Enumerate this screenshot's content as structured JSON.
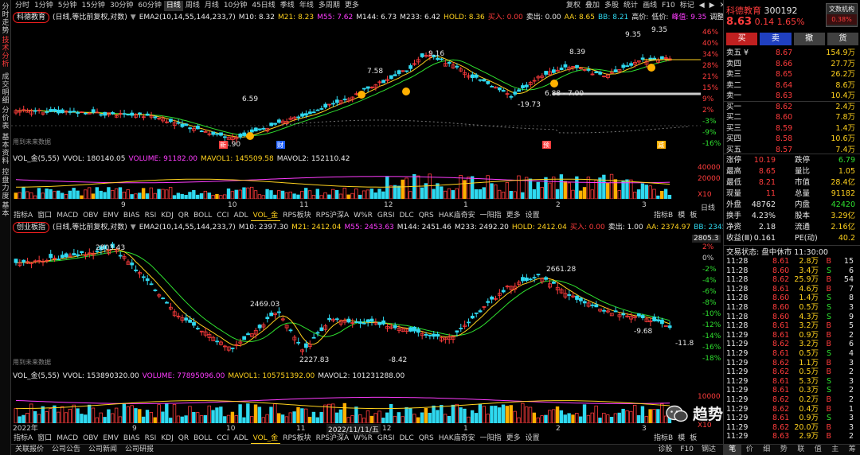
{
  "left_tabs": [
    "分时走势",
    "技术分析",
    "成交明细",
    "分价表",
    "基本资料",
    "控盘力度",
    "基本"
  ],
  "periods": [
    "分时",
    "1分钟",
    "5分钟",
    "15分钟",
    "30分钟",
    "60分钟",
    "日线",
    "周线",
    "月线",
    "10分钟",
    "45日线",
    "季线",
    "年线",
    "多周期",
    "更多"
  ],
  "periods_selected": "日线",
  "toolbar": [
    "复权",
    "叠加",
    "多股",
    "统计",
    "画线",
    "F10",
    "标记",
    "◀",
    "▶",
    "✕"
  ],
  "upper": {
    "stock_label": "科德教育",
    "mode": "(日线,等比前复权,对数)",
    "ema": "EMA2(10,14,55,144,233,7)",
    "m10": "M10: 8.32",
    "m21": "M21: 8.23",
    "m55": "M55: 7.62",
    "m144": "M144: 6.73",
    "m233": "M233: 6.42",
    "hold": "HOLD: 8.36",
    "buy": "买入: 0.00",
    "sell": "卖出: 0.00",
    "aa": "AA: 8.65",
    "bb": "BB: 8.21",
    "hi_prefix": "高价:",
    "lo_prefix": "低价:",
    "peak": "峰值: 9.35",
    "adjust": "调整:",
    "axis": [
      "46%",
      "40%",
      "34%",
      "28%",
      "21%",
      "15%",
      "9%",
      "2%",
      "-3%",
      "-9%",
      "-16%"
    ],
    "annots": [
      "6.59",
      "7.58",
      "9.16",
      "8.39",
      "9.35",
      "9.35",
      "-19.73",
      "6.88 - 7.00",
      "4.90"
    ],
    "future_data": "用到未来数据",
    "event_marks": [
      "新",
      "财",
      "预",
      "减"
    ]
  },
  "vol_upper": {
    "title": "VOL_金(5,55)",
    "vvol": "VVOL: 180140.05",
    "volume": "VOLUME: 91182.00",
    "mavol1": "MAVOL1: 145509.58",
    "mavol2": "MAVOL2: 152110.42",
    "axis": [
      "40000",
      "20000",
      "X10"
    ],
    "months": [
      "9",
      "10",
      "11",
      "12",
      "1",
      "2",
      "3"
    ]
  },
  "indicator_tabs": [
    "指标A",
    "窗口",
    "MACD",
    "OBV",
    "EMV",
    "BIAS",
    "RSI",
    "KDJ",
    "QR",
    "BOLL",
    "CCI",
    "ADL",
    "VOL_金",
    "RPS板块",
    "RPS沪深A",
    "W%R",
    "GRSI",
    "DLC",
    "QRS",
    "HAK庙奇安",
    "一阳指",
    "更多",
    "设置"
  ],
  "indicator_selected": "VOL_金",
  "indicator_right": [
    "指标B",
    "模",
    "板"
  ],
  "day_label": "日线",
  "lower": {
    "index_label": "创业板指",
    "mode": "(日线,等比前复权,对数)",
    "ema": "EMA2(10,14,55,144,233,7)",
    "m10": "M10: 2397.30",
    "m21": "M21: 2412.04",
    "m55": "M55: 2453.63",
    "m144": "M144: 2451.46",
    "m233": "M233: 2492.20",
    "hold": "HOLD: 2412.04",
    "buy": "买入: 0.00",
    "sell": "卖出: 1.00",
    "aa": "AA: 2374.97",
    "bb": "BB: 2345.99",
    "axis": [
      "2%",
      "0%",
      "-2%",
      "-4%",
      "-6%",
      "-8%",
      "-10%",
      "-12%",
      "-14%",
      "-16%",
      "-18%"
    ],
    "axis_top": "2805.3",
    "annots": [
      "2803.43",
      "2469.03",
      "2661.28",
      "2227.83",
      "-8.42",
      "-9.68",
      "-11.8"
    ],
    "future_data": "用到未来数据"
  },
  "vol_lower": {
    "title": "VOL_金(5,55)",
    "vvol": "VVOL: 153890320.00",
    "volume": "VOLUME: 77895096.00",
    "mavol1": "MAVOL1: 105751392.00",
    "mavol2": "MAVOL2: 101231288.00",
    "axis": [
      "10000",
      "X10"
    ],
    "months": [
      "2022年",
      "9",
      "10",
      "11",
      "12",
      "1",
      "2",
      "3"
    ],
    "cursor_date": "2022/11/11/五"
  },
  "bottom_bar": [
    "关联报价",
    "公司公告",
    "公司新闻",
    "公司研报"
  ],
  "bottom_right": [
    "诊股",
    "F10",
    "钢达"
  ],
  "watermark": "趋势一阳指",
  "quote": {
    "name": "科德教育",
    "code": "300192",
    "badge": "文数机构",
    "price": "8.63",
    "change": "0.14",
    "pct": "1.65%",
    "badge_pct": "0.38%",
    "actions": [
      "买",
      "卖",
      "撤",
      "货"
    ],
    "asks": [
      {
        "label": "卖五 ¥",
        "price": "8.67",
        "vol": "154.9万"
      },
      {
        "label": "卖四",
        "price": "8.66",
        "vol": "27.7万"
      },
      {
        "label": "卖三",
        "price": "8.65",
        "vol": "26.2万"
      },
      {
        "label": "卖二",
        "price": "8.64",
        "vol": "8.6万"
      },
      {
        "label": "卖一",
        "price": "8.63",
        "vol": "10.4万"
      }
    ],
    "bids": [
      {
        "label": "买一",
        "price": "8.62",
        "vol": "2.4万"
      },
      {
        "label": "买二",
        "price": "8.60",
        "vol": "7.8万"
      },
      {
        "label": "买三",
        "price": "8.59",
        "vol": "1.4万"
      },
      {
        "label": "买四",
        "price": "8.58",
        "vol": "10.6万"
      },
      {
        "label": "买五",
        "price": "8.57",
        "vol": "7.4万"
      }
    ],
    "stats": [
      {
        "l1": "涨停",
        "v1": "10.19",
        "l2": "跌停",
        "v2": "6.79"
      },
      {
        "l1": "最高",
        "v1": "8.65",
        "l2": "量比",
        "v2": "1.05"
      },
      {
        "l1": "最低",
        "v1": "8.21",
        "l2": "市值",
        "v2": "28.4亿"
      },
      {
        "l1": "现量",
        "v1": "11",
        "l2": "总量",
        "v2": "91182"
      },
      {
        "l1": "外盘",
        "v1": "48762",
        "l2": "内盘",
        "v2": "42420"
      },
      {
        "l1": "换手",
        "v1": "4.23%",
        "l2": "股本",
        "v2": "3.29亿"
      },
      {
        "l1": "净资",
        "v1": "2.18",
        "l2": "流通",
        "v2": "2.16亿"
      },
      {
        "l1": "收益(Ⅲ)",
        "v1": "0.161",
        "l2": "PE(动)",
        "v2": "40.2"
      }
    ],
    "status": "交易状态: 盘中休市 11:30:00",
    "ticks": [
      {
        "t": "11:28",
        "p": "8.61",
        "v": "2.8万",
        "d": "B",
        "n": "15"
      },
      {
        "t": "11:28",
        "p": "8.60",
        "v": "3.4万",
        "d": "S",
        "n": "6"
      },
      {
        "t": "11:28",
        "p": "8.62",
        "v": "25.9万",
        "d": "B",
        "n": "54"
      },
      {
        "t": "11:28",
        "p": "8.61",
        "v": "4.6万",
        "d": "B",
        "n": "7"
      },
      {
        "t": "11:28",
        "p": "8.60",
        "v": "1.4万",
        "d": "S",
        "n": "8"
      },
      {
        "t": "11:28",
        "p": "8.60",
        "v": "0.5万",
        "d": "S",
        "n": "3"
      },
      {
        "t": "11:28",
        "p": "8.60",
        "v": "4.3万",
        "d": "S",
        "n": "9"
      },
      {
        "t": "11:28",
        "p": "8.61",
        "v": "3.2万",
        "d": "B",
        "n": "5"
      },
      {
        "t": "11:29",
        "p": "8.61",
        "v": "0.9万",
        "d": "B",
        "n": "2"
      },
      {
        "t": "11:29",
        "p": "8.62",
        "v": "3.2万",
        "d": "B",
        "n": "6"
      },
      {
        "t": "11:29",
        "p": "8.61",
        "v": "0.5万",
        "d": "S",
        "n": "4"
      },
      {
        "t": "11:29",
        "p": "8.62",
        "v": "1.1万",
        "d": "B",
        "n": "3"
      },
      {
        "t": "11:29",
        "p": "8.62",
        "v": "0.5万",
        "d": "B",
        "n": "2"
      },
      {
        "t": "11:29",
        "p": "8.61",
        "v": "5.3万",
        "d": "S",
        "n": "3"
      },
      {
        "t": "11:29",
        "p": "8.61",
        "v": "0.3万",
        "d": "S",
        "n": "2"
      },
      {
        "t": "11:29",
        "p": "8.62",
        "v": "0.2万",
        "d": "B",
        "n": "2"
      },
      {
        "t": "11:29",
        "p": "8.62",
        "v": "0.4万",
        "d": "B",
        "n": "1"
      },
      {
        "t": "11:29",
        "p": "8.61",
        "v": "0.9万",
        "d": "S",
        "n": "3"
      },
      {
        "t": "11:29",
        "p": "8.62",
        "v": "20.0万",
        "d": "B",
        "n": "3"
      },
      {
        "t": "11:29",
        "p": "8.63",
        "v": "2.9万",
        "d": "B",
        "n": "2"
      }
    ],
    "footer": [
      "笔",
      "价",
      "细",
      "势",
      "联",
      "值",
      "主",
      "筹"
    ]
  },
  "colors": {
    "up": "#ff3c3c",
    "down": "#2fd9f0",
    "yellow": "#ffd21e",
    "green": "#2fe02f",
    "magenta": "#ff3cff"
  }
}
